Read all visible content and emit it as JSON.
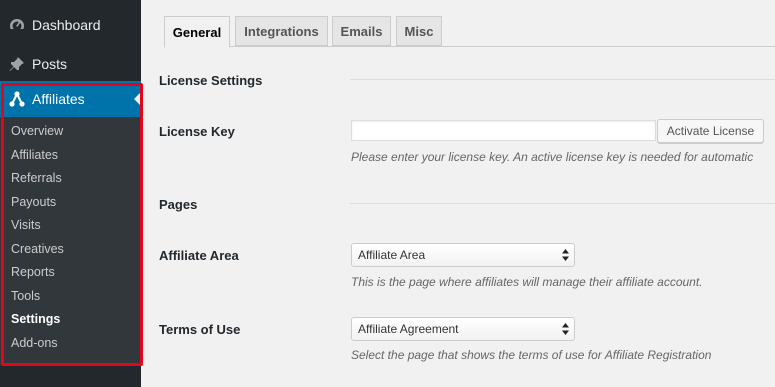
{
  "sidebar": {
    "top_items": [
      {
        "label": "Dashboard",
        "icon": "dashboard-icon"
      },
      {
        "label": "Posts",
        "icon": "pushpin-icon"
      },
      {
        "label": "Affiliates",
        "icon": "affiliate-network-icon",
        "active": true
      }
    ],
    "submenu": [
      "Overview",
      "Affiliates",
      "Referrals",
      "Payouts",
      "Visits",
      "Creatives",
      "Reports",
      "Tools",
      "Settings",
      "Add-ons"
    ],
    "current_submenu": "Settings",
    "highlight_color": "#e3051b",
    "active_color": "#0073aa"
  },
  "tabs": [
    {
      "label": "General",
      "active": true
    },
    {
      "label": "Integrations"
    },
    {
      "label": "Emails"
    },
    {
      "label": "Misc"
    }
  ],
  "sections": {
    "license_settings": "License Settings",
    "pages": "Pages"
  },
  "license": {
    "label": "License Key",
    "value": "",
    "button": "Activate License",
    "description": "Please enter your license key. An active license key is needed for automatic"
  },
  "affiliate_area": {
    "label": "Affiliate Area",
    "selected": "Affiliate Area",
    "description": "This is the page where affiliates will manage their affiliate account."
  },
  "terms": {
    "label": "Terms of Use",
    "selected": "Affiliate Agreement",
    "description": "Select the page that shows the terms of use for Affiliate Registration"
  }
}
